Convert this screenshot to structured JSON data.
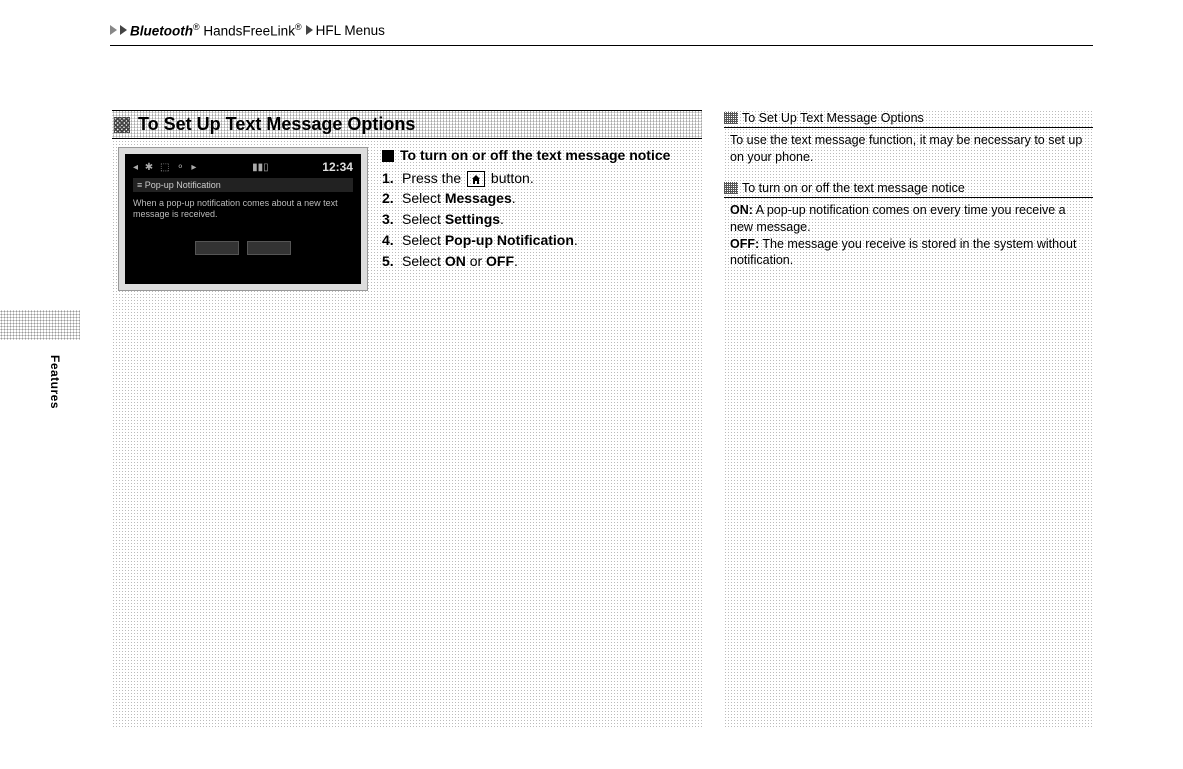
{
  "breadcrumb": {
    "part1_italic": "Bluetooth",
    "part1_reg_mark": "®",
    "part1_rest": " HandsFreeLink",
    "part1_reg_mark2": "®",
    "part2": "HFL Menus"
  },
  "side_tab": "Features",
  "main": {
    "section_title": "To Set Up Text Message Options",
    "device": {
      "clock": "12:34",
      "subhead": "≡ Pop-up Notification",
      "body_text": "When a pop-up notification comes about a new text message is received.",
      "btn1": "",
      "btn2": ""
    },
    "instructions": {
      "heading": "To turn on or off the text message notice",
      "steps": [
        {
          "num": "1.",
          "pre": "Press the ",
          "post": " button."
        },
        {
          "num": "2.",
          "pre": "Select ",
          "bold": "Messages",
          "post": "."
        },
        {
          "num": "3.",
          "pre": "Select ",
          "bold": "Settings",
          "post": "."
        },
        {
          "num": "4.",
          "pre": "Select ",
          "bold": "Pop-up Notification",
          "post": "."
        },
        {
          "num": "5.",
          "pre": "Select ",
          "bold": "ON",
          "mid": " or ",
          "bold2": "OFF",
          "post": "."
        }
      ]
    }
  },
  "sidebar": {
    "notes": [
      {
        "title": "To Set Up Text Message Options",
        "body_plain": "To use the text message function, it may be necessary to set up on your phone."
      },
      {
        "title": "To turn on or off the text message notice",
        "on_label": "ON:",
        "on_text": " A pop-up notification comes on every time you receive a new message.",
        "off_label": "OFF:",
        "off_text": " The message you receive is stored in the system without notification."
      }
    ]
  }
}
